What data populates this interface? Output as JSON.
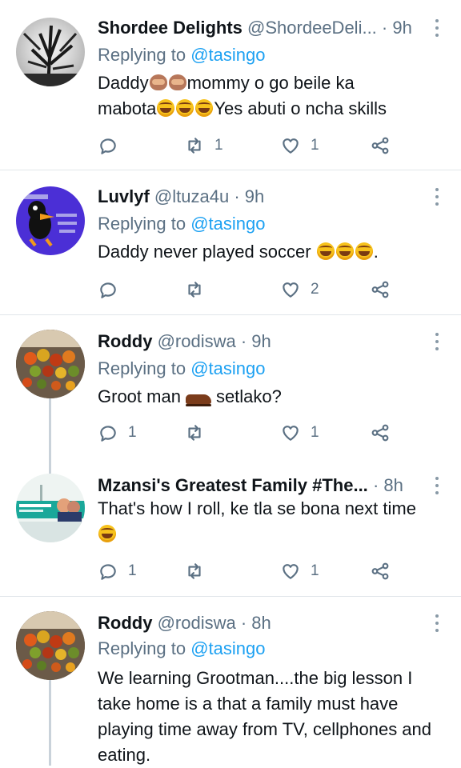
{
  "tweets": [
    {
      "name": "Shordee Delights",
      "handle": "@ShordeeDeli...",
      "dot": "·",
      "time": "9h",
      "reply_prefix": "Replying to",
      "reply_to": "@tasingo",
      "text_parts": [
        "Daddy",
        "mommy o go beile ka",
        "mabota",
        "Yes abuti o ncha skills"
      ],
      "reply_count": "",
      "retweet_count": "1",
      "like_count": "1",
      "avatar_icon": "tree-silhouette-avatar"
    },
    {
      "name": "Luvlyf",
      "handle": "@ltuza4u",
      "dot": "·",
      "time": "9h",
      "reply_prefix": "Replying to",
      "reply_to": "@tasingo",
      "text_parts": [
        "Daddy never played soccer",
        "."
      ],
      "reply_count": "",
      "retweet_count": "",
      "like_count": "2",
      "avatar_icon": "cartoon-duck-avatar"
    },
    {
      "name": "Roddy",
      "handle": "@rodiswa",
      "dot": "·",
      "time": "9h",
      "reply_prefix": "Replying to",
      "reply_to": "@tasingo",
      "text_parts": [
        "Groot man",
        "setlako?"
      ],
      "reply_count": "1",
      "retweet_count": "",
      "like_count": "1",
      "avatar_icon": "fruit-bowl-avatar"
    },
    {
      "name": "Mzansi's Greatest Family #The...",
      "handle": "",
      "dot": "·",
      "time": "8h",
      "text_parts": [
        "That's how I roll, ke tla se bona next time"
      ],
      "reply_count": "1",
      "retweet_count": "",
      "like_count": "1",
      "avatar_icon": "tv-show-logo-avatar"
    },
    {
      "name": "Roddy",
      "handle": "@rodiswa",
      "dot": "·",
      "time": "8h",
      "reply_prefix": "Replying to",
      "reply_to": "@tasingo",
      "text": "We learning Grootman....the big lesson I take home is a that a family must have playing time away from TV, cellphones and eating.",
      "avatar_icon": "fruit-bowl-avatar"
    }
  ],
  "icons": {
    "reply": "reply-icon",
    "retweet": "retweet-icon",
    "like": "like-icon",
    "share": "share-icon",
    "more": "more-options-icon"
  },
  "colors": {
    "link": "#1da1f2",
    "secondary_text": "#5b7083",
    "primary_text": "#0f1419"
  }
}
